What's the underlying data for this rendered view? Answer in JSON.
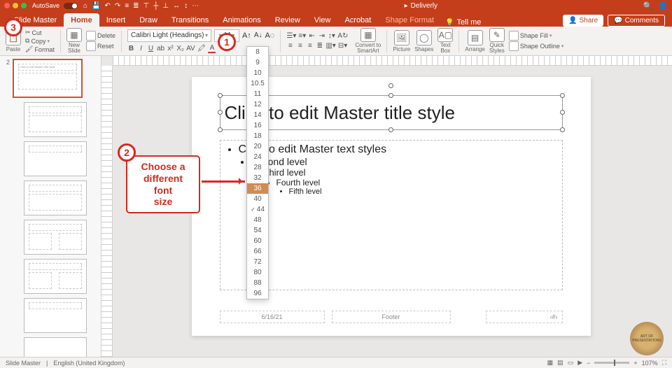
{
  "titlebar": {
    "autosave": "AutoSave",
    "docname": "Deliverly"
  },
  "tabs": {
    "slide_master": "Slide Master",
    "home": "Home",
    "insert": "Insert",
    "draw": "Draw",
    "transitions": "Transitions",
    "animations": "Animations",
    "review": "Review",
    "view": "View",
    "acrobat": "Acrobat",
    "shape_format": "Shape Format",
    "tell_me": "Tell me",
    "share": "Share",
    "comments": "Comments"
  },
  "ribbon": {
    "paste": "Paste",
    "cut": "Cut",
    "copy": "Copy",
    "format": "Format",
    "new_slide": "New\nSlide",
    "delete": "Delete",
    "reset": "Reset",
    "font_name": "Calibri Light (Headings)",
    "font_size": "44",
    "convert": "Convert to\nSmartArt",
    "picture": "Picture",
    "shapes": "Shapes",
    "textbox": "Text\nBox",
    "arrange": "Arrange",
    "quick_styles": "Quick\nStyles",
    "shape_fill": "Shape Fill",
    "shape_outline": "Shape Outline"
  },
  "font_sizes": [
    "8",
    "9",
    "10",
    "10.5",
    "11",
    "12",
    "14",
    "16",
    "18",
    "20",
    "24",
    "28",
    "32",
    "36",
    "40",
    "44",
    "48",
    "54",
    "60",
    "66",
    "72",
    "80",
    "88",
    "96"
  ],
  "slide": {
    "title": "Click to edit Master title style",
    "body_l1": "Click to edit Master text styles",
    "body_l2": "Second level",
    "body_l3": "Third level",
    "body_l4": "Fourth level",
    "body_l5": "Fifth level",
    "date": "6/16/21",
    "footer": "Footer",
    "num": "‹#›"
  },
  "callouts": {
    "c1": "1",
    "c2": "2",
    "c3": "3",
    "box": "Choose a\ndifferent font\nsize"
  },
  "status": {
    "mode": "Slide Master",
    "lang": "English (United Kingdom)",
    "zoom": "107%"
  },
  "thumb": {
    "title_text": "Click to edit Master title style"
  },
  "logo": "ART OF\nPRESENTATIONS"
}
